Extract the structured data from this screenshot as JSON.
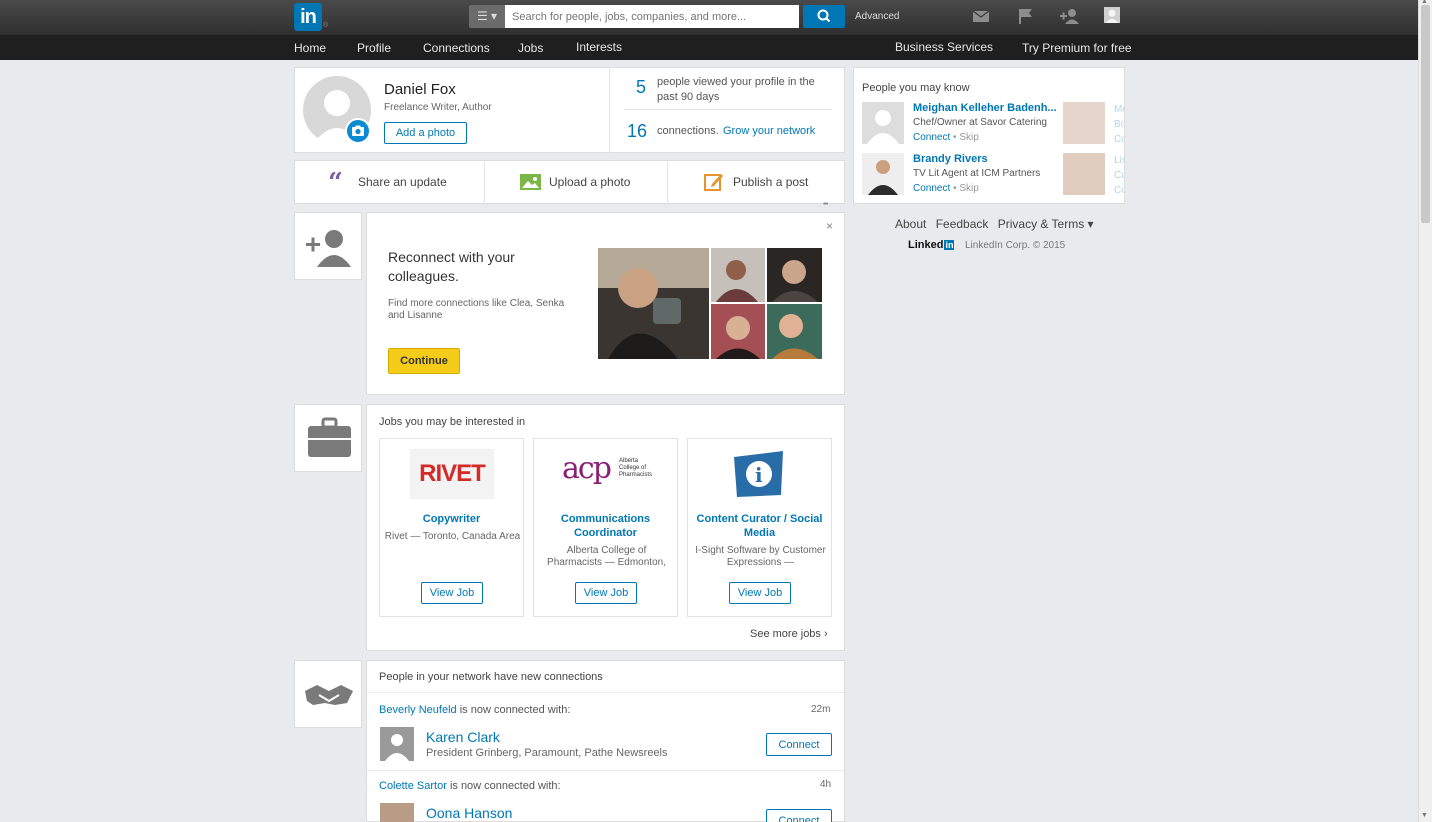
{
  "topbar": {
    "logo": "in",
    "search_placeholder": "Search for people, jobs, companies, and more...",
    "advanced": "Advanced"
  },
  "nav": {
    "items": [
      "Home",
      "Profile",
      "Connections",
      "Jobs",
      "Interests"
    ],
    "right": [
      "Business Services",
      "Try Premium for free"
    ]
  },
  "profile": {
    "name": "Daniel Fox",
    "headline": "Freelance Writer, Author",
    "add_photo": "Add a photo",
    "views_count": "5",
    "views_text": "people viewed your profile in the past 90 days",
    "connections_count": "16",
    "connections_text": "connections.",
    "grow_link": "Grow your network"
  },
  "share": {
    "update": "Share an update",
    "photo": "Upload a photo",
    "post": "Publish a post",
    "more": "•••"
  },
  "reconnect": {
    "title": "Reconnect with your colleagues.",
    "text": "Find more connections like Clea, Senka and Lisanne",
    "button": "Continue",
    "close": "×"
  },
  "jobs": {
    "header": "Jobs you may be interested in",
    "items": [
      {
        "logo": "RIVET",
        "title": "Copywriter",
        "company": "Rivet — Toronto, Canada Area",
        "button": "View Job"
      },
      {
        "logo": "acp",
        "logo_sub": "Alberta College of Pharmacists",
        "title": "Communications Coordinator",
        "company": "Alberta College of Pharmacists — Edmonton,",
        "button": "View Job"
      },
      {
        "logo": "i",
        "title": "Content Curator / Social Media",
        "company": "I-Sight Software by Customer Expressions —",
        "button": "View Job"
      }
    ],
    "see_more": "See more jobs ›"
  },
  "network": {
    "header": "People in your network have new connections",
    "items": [
      {
        "who": "Beverly Neufeld",
        "text": "is now connected with:",
        "time": "22m",
        "name": "Karen Clark",
        "title": "President Grinberg, Paramount, Pathe Newsreels",
        "button": "Connect"
      },
      {
        "who": "Colette Sartor",
        "text": "is now connected with:",
        "time": "4h",
        "name": "Oona Hanson",
        "title": "",
        "button": "Connect"
      }
    ]
  },
  "pymk": {
    "header": "People you may know",
    "people": [
      {
        "name": "Meighan Kelleher Badenh...",
        "title": "Chef/Owner at Savor Catering",
        "connect": "Connect",
        "sep": "•",
        "skip": "Skip"
      },
      {
        "name": "Brandy Rivers",
        "title": "TV Lit Agent at ICM Partners",
        "connect": "Connect",
        "sep": "•",
        "skip": "Skip"
      }
    ],
    "peek": [
      [
        "Me",
        "Bo",
        "Co"
      ],
      [
        "Lis",
        "Cu",
        "Co"
      ]
    ]
  },
  "footer": {
    "links": [
      "About",
      "Feedback",
      "Privacy & Terms ▾"
    ],
    "brand": "Linked",
    "brand_in": "in",
    "copyright": "LinkedIn Corp. © 2015"
  },
  "colors": {
    "brand": "#0077b5",
    "continue": "#f5cc19",
    "header_bg": "#2f2f2f",
    "nav_bg": "#1f1f1f"
  }
}
